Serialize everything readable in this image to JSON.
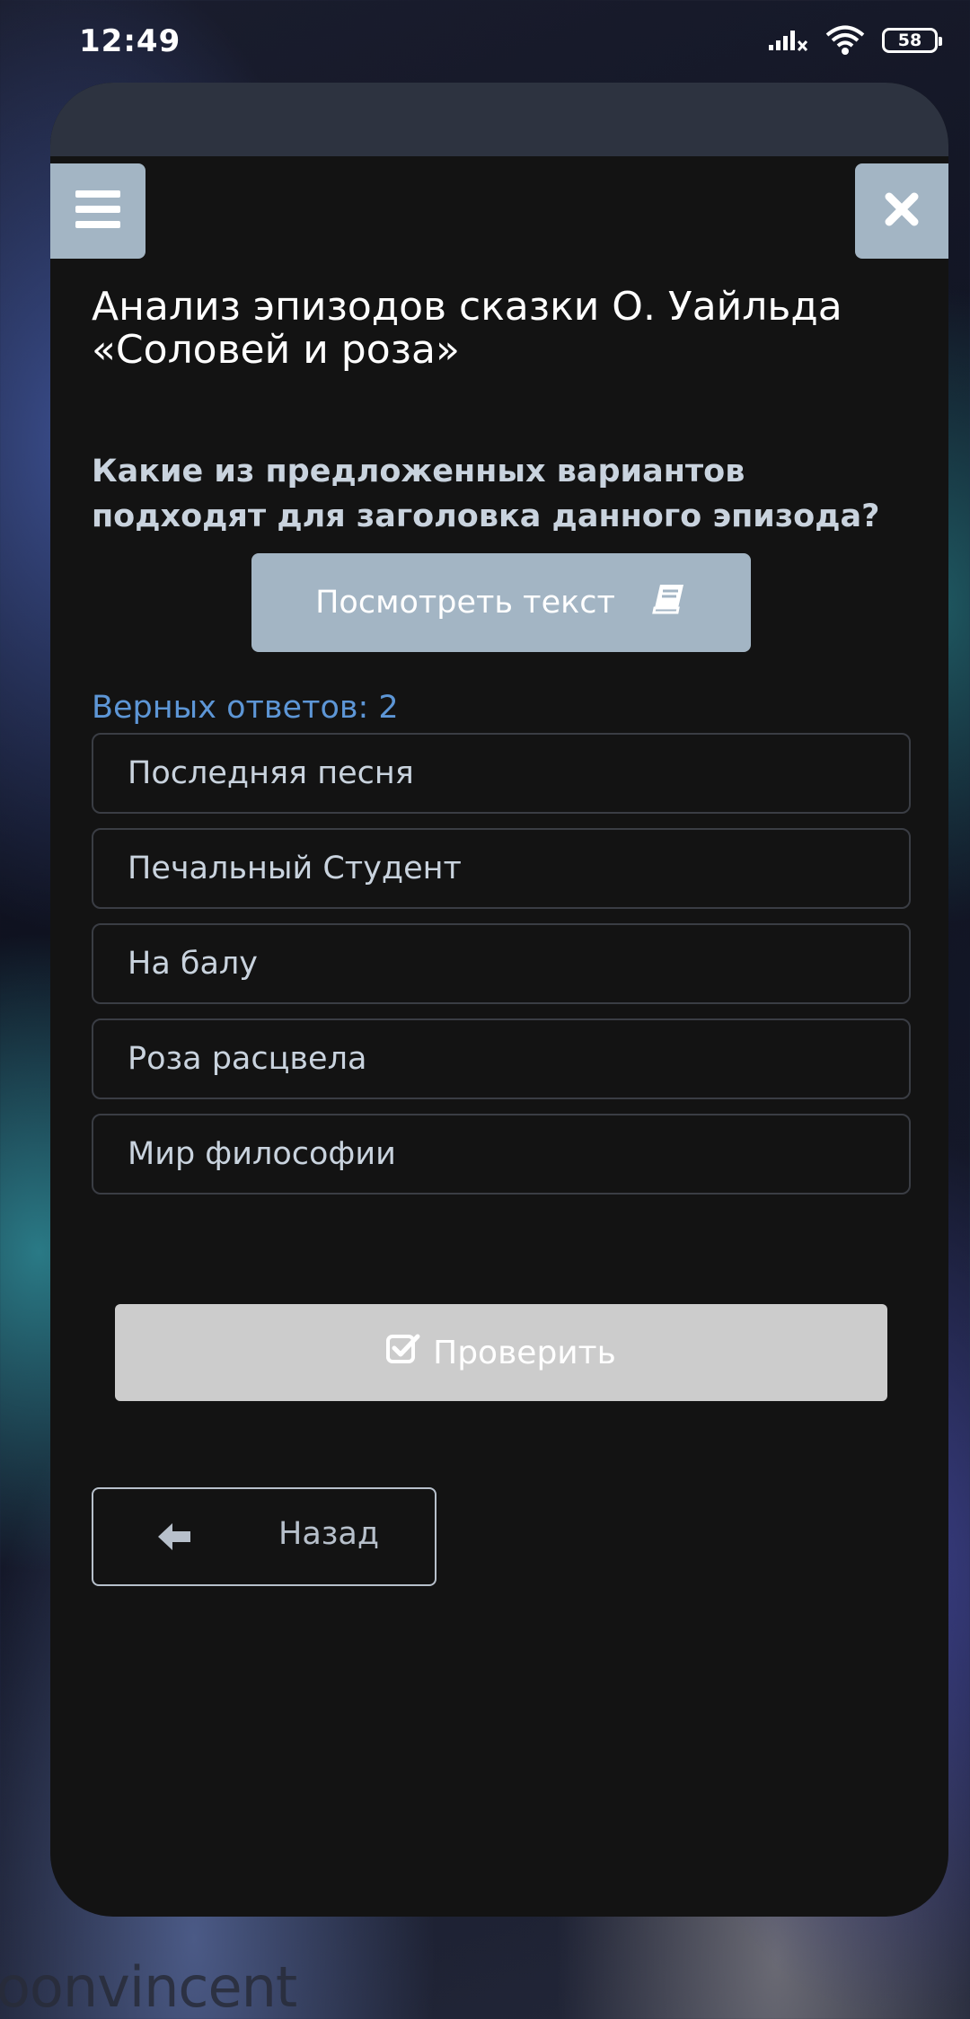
{
  "status_bar": {
    "time": "12:49",
    "battery": "58",
    "icons": [
      "signal-icon",
      "wifi-icon",
      "battery-icon"
    ]
  },
  "header": {
    "menu_icon": "hamburger-icon",
    "close_icon": "close-icon"
  },
  "page": {
    "title": "Анализ эпизодов сказки О. Уайльда «Соловей и роза»",
    "question": "Какие из предложенных вариантов подходят для заголовка данного эпизода?",
    "view_text_label": "Посмотреть текст",
    "view_text_icon": "book-icon",
    "correct_count": "Верных ответов: 2"
  },
  "options": [
    {
      "label": "Последняя песня"
    },
    {
      "label": "Печальный Студент"
    },
    {
      "label": "На балу"
    },
    {
      "label": "Роза расцвела"
    },
    {
      "label": "Мир философии"
    }
  ],
  "actions": {
    "check_label": "Проверить",
    "check_icon": "checkbox-icon",
    "back_label": "Назад",
    "back_icon": "arrow-left-icon"
  },
  "watermark": "oonvincent",
  "colors": {
    "accent": "#a3b5c4",
    "link_blue": "#5d96d6",
    "card_bg": "#131313",
    "topbar": "#2d3340",
    "check_button": "#cccccc"
  }
}
